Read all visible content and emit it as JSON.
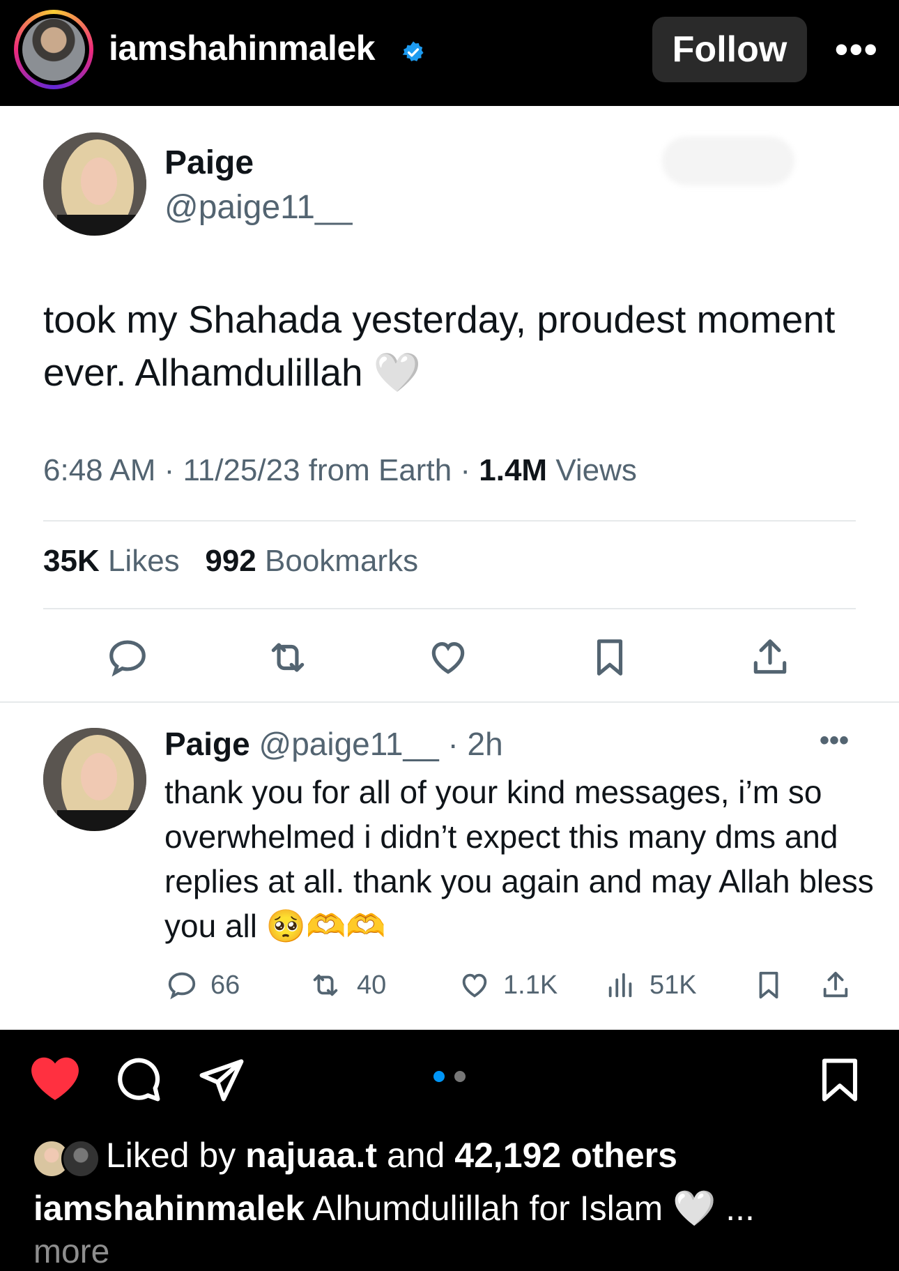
{
  "header": {
    "username": "iamshahinmalek",
    "follow_label": "Follow",
    "more_label": "•••"
  },
  "tweet": {
    "name": "Paige",
    "handle": "@paige11__",
    "text": "took my Shahada yesterday, proudest moment ever. Alhamdulillah 🤍",
    "time_date": "6:48 AM · 11/25/23 from Earth · ",
    "views_count": "1.4M",
    "views_label": " Views",
    "likes_count": "35K",
    "likes_label": " Likes",
    "bookmarks_count": "992",
    "bookmarks_label": " Bookmarks"
  },
  "reply": {
    "name": "Paige",
    "meta": " @paige11__ · 2h",
    "more_label": "•••",
    "text": "thank you for all of your kind messages, i’m so overwhelmed i didn’t expect this many dms and replies at all. thank you again and may Allah bless you all 🥺🫶🫶",
    "comments": "66",
    "retweets": "40",
    "likes": "1.1K",
    "views": "51K"
  },
  "post": {
    "liked_by_prefix": "Liked by ",
    "liked_by_user": "najuaa.t",
    "liked_by_mid": " and ",
    "liked_by_others": "42,192 others",
    "caption_user": "iamshahinmalek",
    "caption_text": " Alhumdulillah for Islam 🤍 ...",
    "more_label": "more"
  },
  "colors": {
    "accent_blue": "#0095f6",
    "like_red": "#ff3040",
    "verified_blue": "#1d9bf0"
  }
}
